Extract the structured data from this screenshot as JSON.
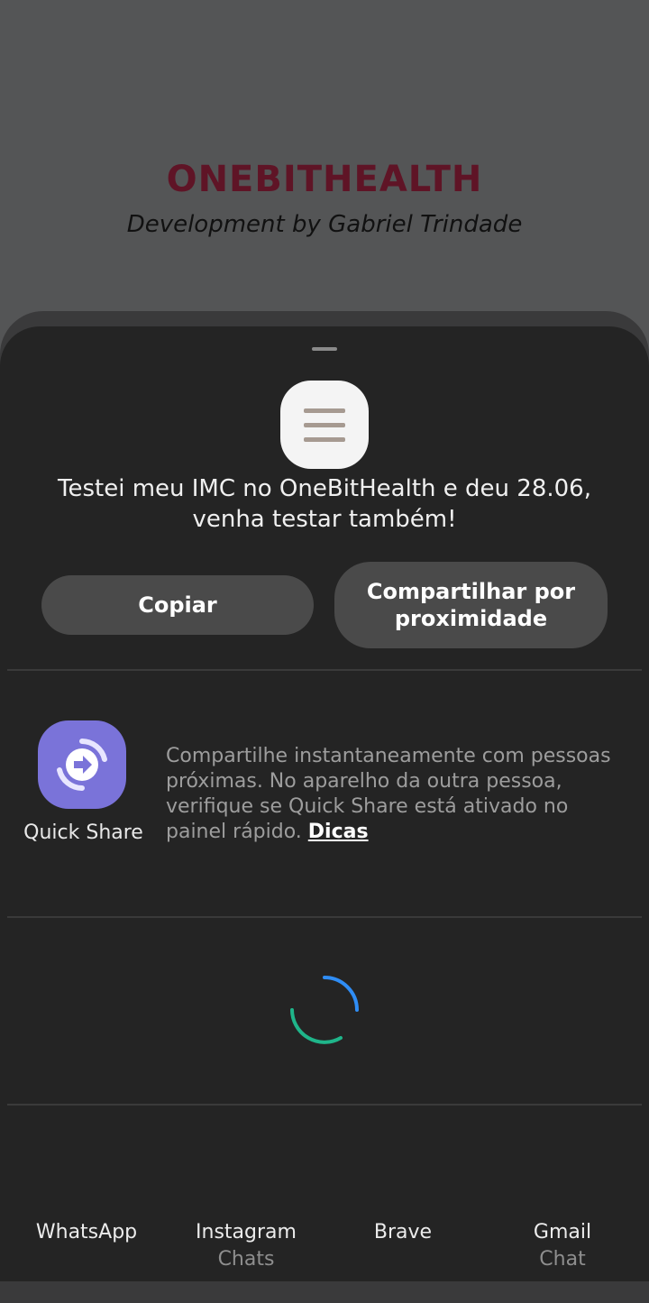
{
  "background_app": {
    "title": "ONEBITHEALTH",
    "subtitle": "Development by Gabriel Trindade"
  },
  "share_sheet": {
    "app_icon": "menu-lines-icon",
    "message": "Testei meu IMC no OneBitHealth e deu 28.06, venha testar também!",
    "buttons": {
      "copy": "Copiar",
      "nearby_share": "Compartilhar por proximidade"
    },
    "quick_share": {
      "label": "Quick Share",
      "icon": "quick-share-icon",
      "description": "Compartilhe instantaneamente com pessoas próximas. No aparelho da outra pessoa, verifique se Quick Share está ativado no painel rápido.",
      "link": "Dicas"
    },
    "loading": "spinner-icon",
    "targets": [
      {
        "name": "WhatsApp",
        "sub": ""
      },
      {
        "name": "Instagram",
        "sub": "Chats"
      },
      {
        "name": "Brave",
        "sub": ""
      },
      {
        "name": "Gmail",
        "sub": "Chat"
      }
    ]
  },
  "colors": {
    "app_background": "#545556",
    "title": "#5f1426",
    "sheet": "#242424",
    "button": "#4a4a4a",
    "quick_share": "#7a73d9",
    "spinner_blue": "#2f8df5",
    "spinner_green": "#1fb58a"
  }
}
